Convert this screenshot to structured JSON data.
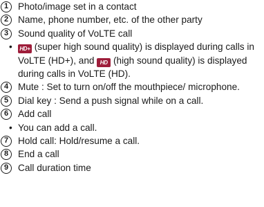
{
  "items": [
    {
      "num": "1",
      "text": "Photo/image set in a contact"
    },
    {
      "num": "2",
      "text": "Name, phone number, etc. of the other party"
    },
    {
      "num": "3",
      "text": "Sound quality of VoLTE call",
      "sub": {
        "bullet": "•",
        "icon1_label": "HD+",
        "text_a": "(super high sound quality) is displayed during calls in VoLTE (HD+), and",
        "icon2_label": "HD",
        "text_b": "(high sound quality) is displayed during calls in VoLTE (HD)."
      }
    },
    {
      "num": "4",
      "text": "Mute : Set to turn on/off the mouthpiece/ microphone."
    },
    {
      "num": "5",
      "text": "Dial key : Send a push signal while on a call."
    },
    {
      "num": "6",
      "text": "Add call",
      "sub": {
        "bullet": "•",
        "text": "You can add a call."
      }
    },
    {
      "num": "7",
      "text": "Hold call: Hold/resume a call."
    },
    {
      "num": "8",
      "text": "End a call"
    },
    {
      "num": "9",
      "text": "Call duration time"
    }
  ],
  "colors": {
    "hd_badge": "#9e1d3a",
    "text": "#1a1a1a"
  }
}
